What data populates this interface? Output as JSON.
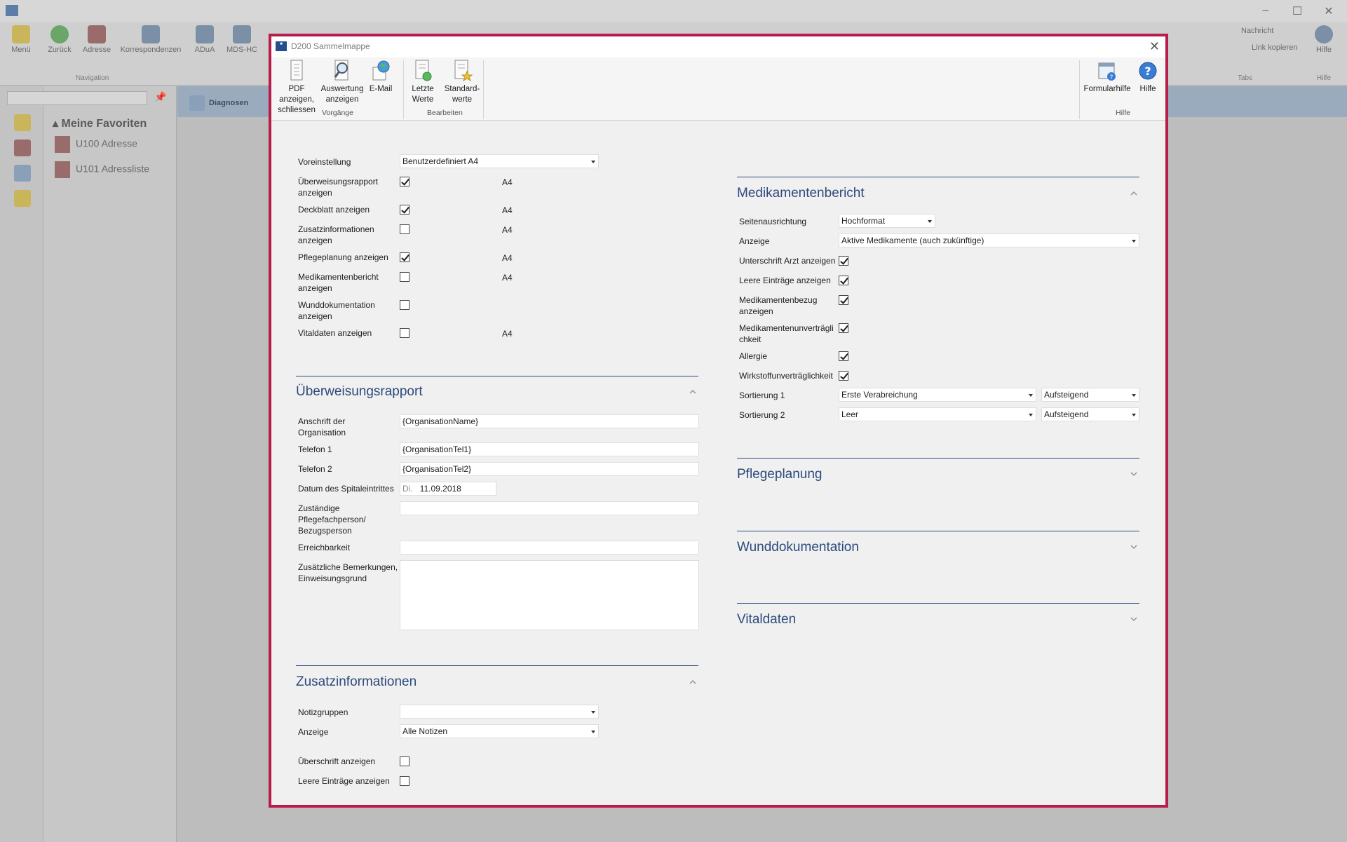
{
  "background_app": {
    "ribbon_buttons": [
      "Menü",
      "Zurück",
      "Adresse",
      "Korrespondenzen",
      "ADuA",
      "MDS-HC"
    ],
    "group_navigation": "Navigation",
    "right_links": [
      "Nachricht",
      "Link kopieren",
      "Hilfe"
    ],
    "group_tabs": "Tabs",
    "group_hilfe": "Hilfe",
    "favorites_title": "Meine Favoriten",
    "favorites": [
      {
        "label": "U100  Adresse"
      },
      {
        "label": "U101  Adressliste"
      }
    ],
    "active_tab": "Diagnosen"
  },
  "dialog": {
    "title": "D200 Sammelmappe",
    "ribbon": {
      "pdf_button": [
        "PDF anzeigen,",
        "schliessen"
      ],
      "auswertung_button": [
        "Auswertung",
        "anzeigen"
      ],
      "email_button": "E-Mail",
      "group_vorgaenge": "Vorgänge",
      "letzte_werte_button": [
        "Letzte",
        "Werte"
      ],
      "standard_werte_button": [
        "Standard-",
        "werte"
      ],
      "group_bearbeiten": "Bearbeiten",
      "formularhilfe_button": "Formularhilfe",
      "hilfe_button": "Hilfe",
      "group_hilfe": "Hilfe"
    },
    "general": {
      "voreinstellung_label": "Voreinstellung",
      "voreinstellung_value": "Benutzerdefiniert A4",
      "rows": [
        {
          "label": [
            "Überweisungsrapport",
            "anzeigen"
          ],
          "checked": true,
          "format": "A4"
        },
        {
          "label": [
            "Deckblatt anzeigen"
          ],
          "checked": true,
          "format": "A4"
        },
        {
          "label": [
            "Zusatzinformationen",
            "anzeigen"
          ],
          "checked": false,
          "format": "A4"
        },
        {
          "label": [
            "Pflegeplanung anzeigen"
          ],
          "checked": true,
          "format": "A4"
        },
        {
          "label": [
            "Medikamentenbericht",
            "anzeigen"
          ],
          "checked": false,
          "format": "A4"
        },
        {
          "label": [
            "Wunddokumentation",
            "anzeigen"
          ],
          "checked": false,
          "format": ""
        },
        {
          "label": [
            "Vitaldaten anzeigen"
          ],
          "checked": false,
          "format": "A4"
        }
      ]
    },
    "ueberweisung": {
      "title": "Überweisungsrapport",
      "anschrift_label": [
        "Anschrift der",
        "Organisation"
      ],
      "anschrift_value": "{OrganisationName}",
      "telefon1_label": "Telefon 1",
      "telefon1_value": "{OrganisationTel1}",
      "telefon2_label": "Telefon 2",
      "telefon2_value": "{OrganisationTel2}",
      "datum_label": "Datum des Spitaleintrittes",
      "datum_weekday": "Di.",
      "datum_value": "11.09.2018",
      "zustaendig_label": [
        "Zuständige",
        "Pflegefachperson/",
        "Bezugsperson"
      ],
      "zustaendig_value": "",
      "erreichbarkeit_label": "Erreichbarkeit",
      "erreichbarkeit_value": "",
      "bemerkungen_label": [
        "Zusätzliche Bemerkungen,",
        "Einweisungsgrund"
      ],
      "bemerkungen_value": ""
    },
    "zusatz": {
      "title": "Zusatzinformationen",
      "notizgruppen_label": "Notizgruppen",
      "notizgruppen_value": "",
      "anzeige_label": "Anzeige",
      "anzeige_value": "Alle Notizen",
      "ueberschrift_label": "Überschrift anzeigen",
      "ueberschrift_checked": false,
      "leere_label": "Leere Einträge anzeigen",
      "leere_checked": false
    },
    "medikamente": {
      "title": "Medikamentenbericht",
      "seitenausrichtung_label": "Seitenausrichtung",
      "seitenausrichtung_value": "Hochformat",
      "anzeige_label": "Anzeige",
      "anzeige_value": "Aktive Medikamente (auch zukünftige)",
      "checks": [
        {
          "label": [
            "Unterschrift Arzt anzeigen"
          ],
          "checked": true
        },
        {
          "label": [
            "Leere Einträge anzeigen"
          ],
          "checked": true
        },
        {
          "label": [
            "Medikamentenbezug",
            "anzeigen"
          ],
          "checked": true
        },
        {
          "label": [
            "Medikamentenunverträgli",
            "chkeit"
          ],
          "checked": true
        },
        {
          "label": [
            "Allergie"
          ],
          "checked": true
        },
        {
          "label": [
            "Wirkstoffunverträglichkeit"
          ],
          "checked": true
        }
      ],
      "sortierung1_label": "Sortierung 1",
      "sortierung1_value": "Erste Verabreichung",
      "sortierung1_dir": "Aufsteigend",
      "sortierung2_label": "Sortierung 2",
      "sortierung2_value": "Leer",
      "sortierung2_dir": "Aufsteigend"
    },
    "collapsed_sections": [
      "Pflegeplanung",
      "Wunddokumentation",
      "Vitaldaten"
    ]
  }
}
